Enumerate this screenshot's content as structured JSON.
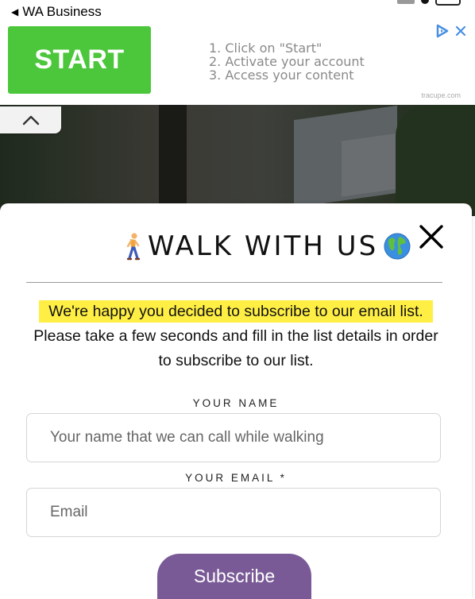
{
  "status_bar": {
    "back_label": "WA Business",
    "back_arrow": "◀"
  },
  "ad": {
    "start_label": "START",
    "steps": [
      "1. Click on \"Start\"",
      "2. Activate your account",
      "3. Access your content"
    ],
    "domain": "tracupe.com",
    "colors": {
      "start_button": "#4cc73c",
      "adchoices": "#4a90e2"
    }
  },
  "collapse_tab": {
    "icon": "chevron-up-icon"
  },
  "modal": {
    "title": "WALK WITH US",
    "title_left_icon": "person-walking-emoji",
    "title_right_icon": "globe-emoji",
    "close_icon": "close-icon",
    "intro_highlight": "We're happy you decided to subscribe to our email list.",
    "intro_line2": "Please take a few seconds and fill in the list details in order",
    "intro_line3": "to subscribe to our list.",
    "name_label": "YOUR NAME",
    "name_placeholder": "Your name that we can call while walking",
    "email_label": "YOUR EMAIL *",
    "email_placeholder": "Email",
    "subscribe_label": "Subscribe",
    "colors": {
      "highlight": "#ffef44",
      "subscribe_button": "#7a5a96"
    }
  }
}
